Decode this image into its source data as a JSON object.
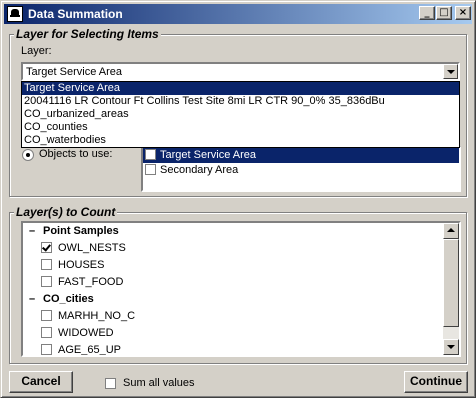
{
  "window": {
    "title": "Data Summation",
    "minimize_glyph": "_",
    "maximize_glyph": "□",
    "close_glyph": "×"
  },
  "layer_group": {
    "legend": "Layer for Selecting Items",
    "layer_label": "Layer:",
    "selected_layer": "Target Service Area",
    "dropdown_options": [
      "Target Service Area",
      "20041116 LR Contour Ft Collins Test Site 8mi LR CTR 90_0% 35_836dBu",
      "CO_urbanized_areas",
      "CO_counties",
      "CO_waterbodies"
    ],
    "objects_label": "Objects to use:",
    "objects_radio_checked": true,
    "objects": [
      {
        "label": "Target Service Area",
        "checked": false,
        "selected": true
      },
      {
        "label": "Secondary Area",
        "checked": false,
        "selected": false
      }
    ]
  },
  "count_group": {
    "legend": "Layer(s) to Count",
    "tree": [
      {
        "type": "heading",
        "label": "Point Samples"
      },
      {
        "type": "item",
        "label": "OWL_NESTS",
        "checked": true
      },
      {
        "type": "item",
        "label": "HOUSES",
        "checked": false
      },
      {
        "type": "item",
        "label": "FAST_FOOD",
        "checked": false
      },
      {
        "type": "heading",
        "label": "CO_cities"
      },
      {
        "type": "item",
        "label": "MARHH_NO_C",
        "checked": false
      },
      {
        "type": "item",
        "label": "WIDOWED",
        "checked": false
      },
      {
        "type": "item",
        "label": "AGE_65_UP",
        "checked": false
      }
    ]
  },
  "footer": {
    "cancel_label": "Cancel",
    "sum_all_label": "Sum all values",
    "sum_all_checked": false,
    "continue_label": "Continue"
  }
}
